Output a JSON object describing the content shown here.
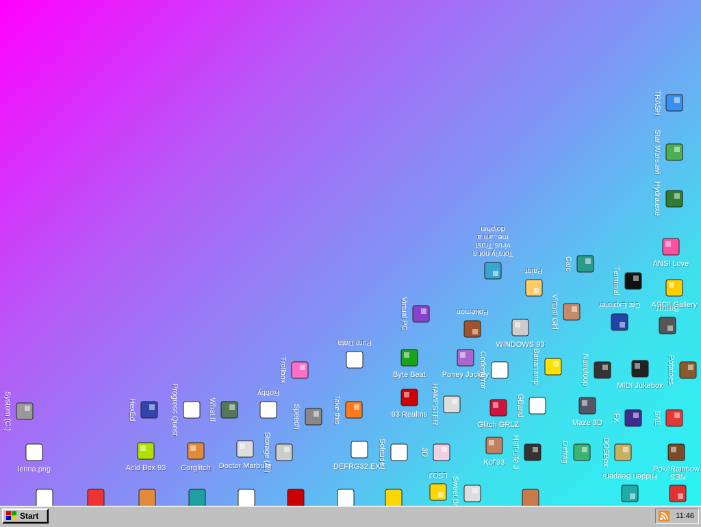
{
  "desktop_icons": [
    {
      "label": "TRASH",
      "icon": "trash-icon"
    },
    {
      "label": "Star Wars.avi",
      "icon": "yoda-icon"
    },
    {
      "label": "Hydra.exe",
      "icon": "hydra-icon"
    },
    {
      "label": "ANSI Love",
      "icon": "ansi-love-icon"
    },
    {
      "label": "Calc",
      "icon": "calculator-icon"
    },
    {
      "label": "Terminal",
      "icon": "terminal-icon"
    },
    {
      "label": "ASCII Gallery",
      "icon": "ascii-gallery-icon"
    },
    {
      "label": "Cat Explorer",
      "icon": "cat-explorer-icon"
    },
    {
      "label": "Paint",
      "icon": "paint-palette-icon"
    },
    {
      "label": "Virtual Girl",
      "icon": "virtual-girl-icon"
    },
    {
      "label": "Totally not a virus.Trust me...im a dolphin",
      "icon": "dolphin-icon"
    },
    {
      "label": "Virtual PC",
      "icon": "virtual-pc-icon"
    },
    {
      "label": "Pokémon",
      "icon": "pokemon-icon"
    },
    {
      "label": "WINDOWS 93",
      "icon": "windows93-icon"
    },
    {
      "label": "Brrrrrrr",
      "icon": "brrrr-icon"
    },
    {
      "label": "Potatoes",
      "icon": "potato-icon"
    },
    {
      "label": "MIDI Jukebox",
      "icon": "midi-jukebox-icon"
    },
    {
      "label": "Nanoloop",
      "icon": "nanoloop-icon"
    },
    {
      "label": "Bananamp",
      "icon": "banana-icon"
    },
    {
      "label": "Codemirror",
      "icon": "codemirror-icon"
    },
    {
      "label": "Poney Jockey",
      "icon": "pony-icon"
    },
    {
      "label": "Byte Beat",
      "icon": "byte-beat-icon"
    },
    {
      "label": "Pure Data",
      "icon": "pure-data-icon"
    },
    {
      "label": "Trollbox",
      "icon": "trollbox-icon"
    },
    {
      "label": "SAE",
      "icon": "sae-ball-icon"
    },
    {
      "label": "FX",
      "icon": "atom-icon"
    },
    {
      "label": "Maze 3D",
      "icon": "maze-icon"
    },
    {
      "label": "Glitch GRLZ",
      "icon": "lips-icon"
    },
    {
      "label": "GBand",
      "icon": "gband-icon"
    },
    {
      "label": "HAMPSTER",
      "icon": "hampster-icon"
    },
    {
      "label": "93 Realms",
      "icon": "realms-icon"
    },
    {
      "label": "Take this",
      "icon": "take-this-icon"
    },
    {
      "label": "Speech",
      "icon": "speech-icon"
    },
    {
      "label": "Robby",
      "icon": "robby-icon"
    },
    {
      "label": "What If",
      "icon": "what-if-icon"
    },
    {
      "label": "Progress Quest",
      "icon": "progress-quest-icon"
    },
    {
      "label": "HexEd",
      "icon": "hexed-icon"
    },
    {
      "label": "System (C:)",
      "icon": "system-drive-icon"
    },
    {
      "label": "lenna.png",
      "icon": "lenna-file-icon"
    },
    {
      "label": "Acid Box 93",
      "icon": "smiley-icon"
    },
    {
      "label": "Corglitch",
      "icon": "corgi-icon"
    },
    {
      "label": "Doctor Marburg",
      "icon": "doctor-icon"
    },
    {
      "label": "Storage (A:)",
      "icon": "floppy-drive-icon"
    },
    {
      "label": "DEFRG32.EXE",
      "icon": "defrag-exe-icon"
    },
    {
      "label": "Solitude",
      "icon": "solitude-icon"
    },
    {
      "label": "3D",
      "icon": "3d-icon"
    },
    {
      "label": "Kof'93",
      "icon": "kof-icon"
    },
    {
      "label": "Half-Life 3",
      "icon": "half-life-icon"
    },
    {
      "label": "Defrag",
      "icon": "defrag-icon"
    },
    {
      "label": "DOSBox",
      "icon": "dosbox-icon"
    },
    {
      "label": "PokéRainbow",
      "icon": "pokerainbow-icon"
    },
    {
      "label": "Hidden Beepers",
      "icon": "beepers-icon"
    },
    {
      "label": "NES",
      "icon": "nes-icon"
    },
    {
      "label": "Sweet Brb",
      "icon": "sweet-icon"
    },
    {
      "label": "LSDJ",
      "icon": "lsdj-icon"
    }
  ],
  "bottom_row_icons": [
    "document-icon",
    "book-icon",
    "pizza-icon",
    "cube-icon",
    "letter-icon",
    "console-icon",
    "notepad-icon",
    "question-icon",
    "guy-icon"
  ],
  "taskbar": {
    "start_label": "Start",
    "clock": "11:46"
  },
  "colors": {
    "gradient_start": "#ff00ff",
    "gradient_mid": "#7f96f6",
    "gradient_end": "#2bf3f3",
    "taskbar": "#c0c0c0"
  }
}
